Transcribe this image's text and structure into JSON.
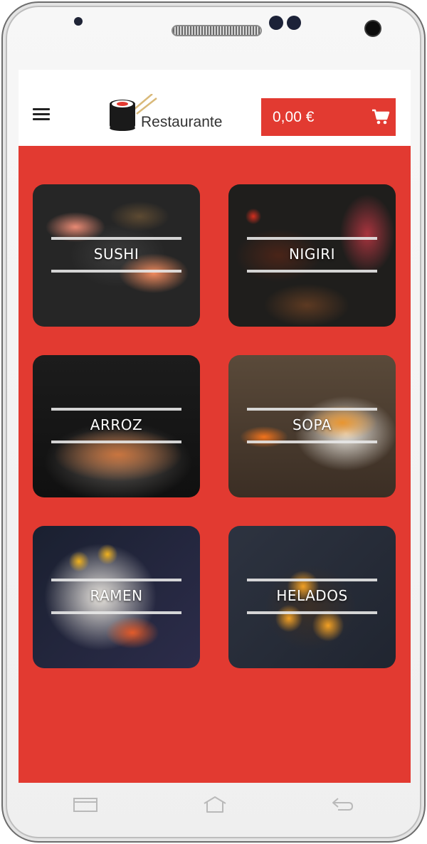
{
  "header": {
    "brand": "Restaurante",
    "cart_total": "0,00 €",
    "icons": {
      "menu": "hamburger-icon",
      "logo": "sushi-logo-icon",
      "cart": "cart-icon"
    }
  },
  "categories": [
    {
      "label": "SUSHI"
    },
    {
      "label": "NIGIRI"
    },
    {
      "label": "ARROZ"
    },
    {
      "label": "SOPA"
    },
    {
      "label": "RAMEN"
    },
    {
      "label": "HELADOS"
    }
  ],
  "colors": {
    "accent": "#e23a31",
    "header_bg": "#ffffff",
    "text_dark": "#333333"
  },
  "device_nav": {
    "icons": [
      "recent-apps-icon",
      "home-icon",
      "back-icon"
    ]
  }
}
